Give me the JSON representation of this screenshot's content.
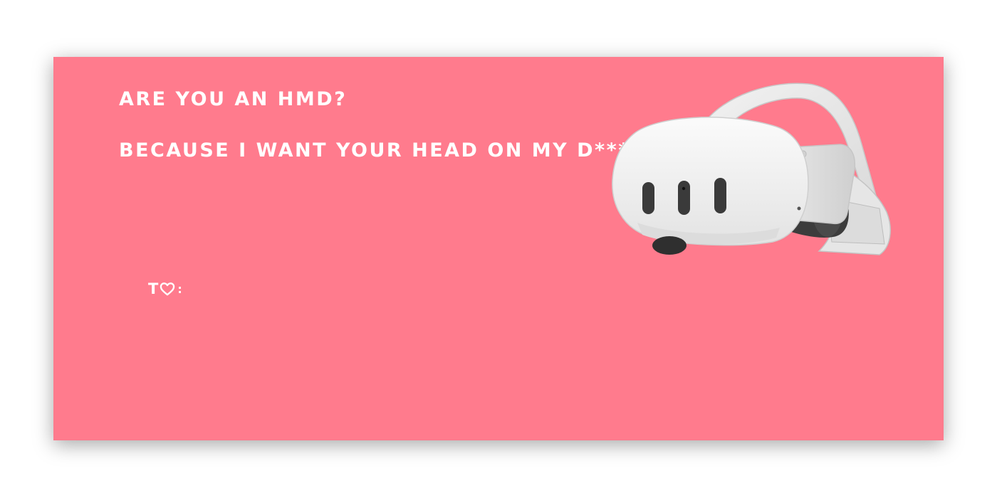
{
  "card": {
    "line1": "ARE YOU AN HMD?",
    "line2": "BECAUSE I WANT YOUR HEAD ON MY D***",
    "to_prefix": "T",
    "to_suffix": ":",
    "background_color": "#ff7b8d",
    "text_color": "#ffffff"
  },
  "icons": {
    "heart": "heart-icon",
    "headset": "vr-headset-illustration"
  }
}
